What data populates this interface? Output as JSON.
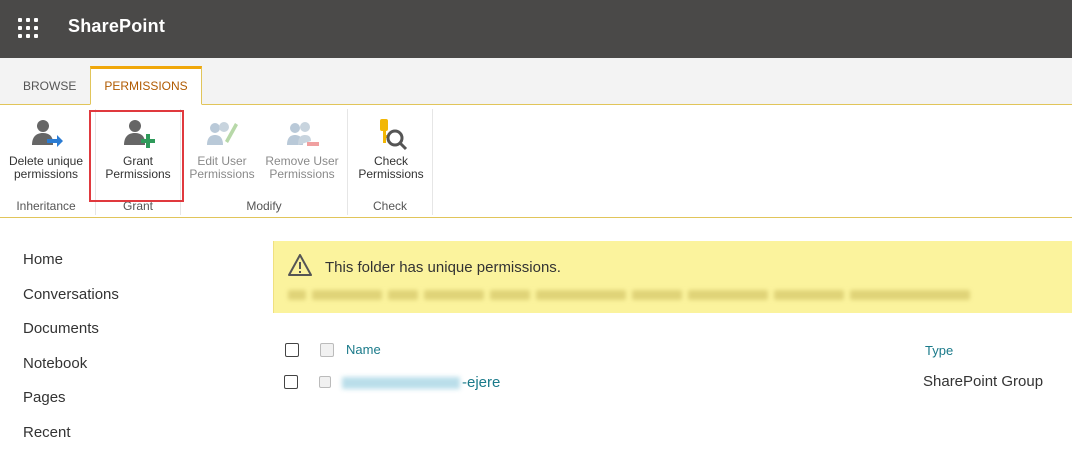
{
  "app": {
    "title": "SharePoint"
  },
  "ribbon": {
    "tabs": [
      {
        "label": "BROWSE",
        "selected": false
      },
      {
        "label": "PERMISSIONS",
        "selected": true
      }
    ],
    "buttons": {
      "delete_unique": {
        "line1": "Delete unique",
        "line2": "permissions",
        "icon": "user-arrow-icon",
        "enabled": true
      },
      "grant": {
        "line1": "Grant",
        "line2": "Permissions",
        "icon": "user-plus-icon",
        "enabled": true
      },
      "edit_user": {
        "line1": "Edit User",
        "line2": "Permissions",
        "icon": "users-edit-icon",
        "enabled": false
      },
      "remove_user": {
        "line1": "Remove User",
        "line2": "Permissions",
        "icon": "users-minus-icon",
        "enabled": false
      },
      "check": {
        "line1": "Check",
        "line2": "Permissions",
        "icon": "key-search-icon",
        "enabled": true
      }
    },
    "groups": [
      "Inheritance",
      "Grant",
      "Modify",
      "Check"
    ]
  },
  "nav": {
    "items": [
      "Home",
      "Conversations",
      "Documents",
      "Notebook",
      "Pages",
      "Recent"
    ]
  },
  "banner": {
    "message": "This folder has unique permissions."
  },
  "table": {
    "headers": {
      "name": "Name",
      "type": "Type"
    },
    "rows": [
      {
        "name_suffix": "-ejere",
        "type": "SharePoint Group"
      }
    ]
  },
  "colors": {
    "suitebar": "#4a4948",
    "accent": "#f0a70a",
    "link": "#1a7a8a",
    "banner": "#fbf39d",
    "highlight_box": "#e0393e"
  }
}
